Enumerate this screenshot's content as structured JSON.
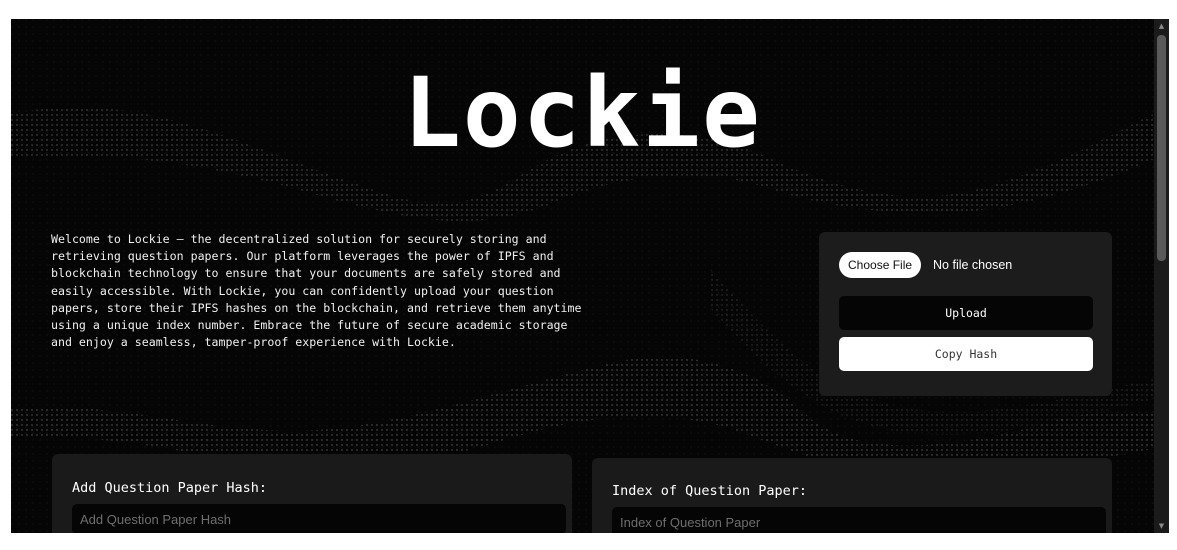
{
  "app": {
    "title": "Lockie"
  },
  "intro": {
    "text": "Welcome to Lockie – the decentralized solution for securely storing and retrieving question papers. Our platform leverages the power of IPFS and blockchain technology to ensure that your documents are safely stored and easily accessible. With Lockie, you can confidently upload your question papers, store their IPFS hashes on the blockchain, and retrieve them anytime using a unique index number. Embrace the future of secure academic storage and enjoy a seamless, tamper-proof experience with Lockie."
  },
  "upload_card": {
    "choose_file_label": "Choose File",
    "file_status": "No file chosen",
    "upload_label": "Upload",
    "copy_hash_label": "Copy Hash"
  },
  "add_hash_panel": {
    "label": "Add Question Paper Hash:",
    "placeholder": "Add Question Paper Hash"
  },
  "index_panel": {
    "label": "Index of Question Paper:",
    "placeholder": "Index of Question Paper"
  },
  "scrollbar": {
    "up_icon": "scroll-up-arrow",
    "down_icon": "scroll-down-arrow"
  },
  "colors": {
    "background": "#050505",
    "card": "#1c1c1c",
    "text": "#ffffff"
  }
}
